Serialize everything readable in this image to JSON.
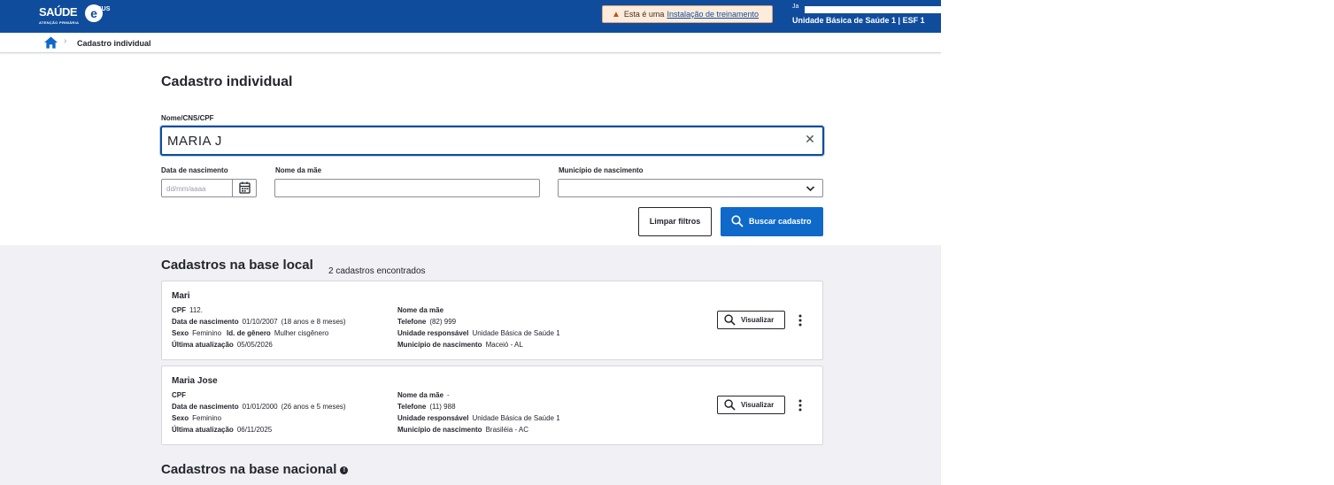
{
  "header": {
    "brand": "SAÚDE",
    "brand_sub": "ATENÇÃO PRIMÁRIA",
    "brand_e": "e",
    "brand_sus": "SUS",
    "training_prefix": "Esta é uma",
    "training_link": "Instalação de treinamento",
    "user_name": "Ja",
    "user_unit": "Unidade Básica de Saúde 1 | ESF 1"
  },
  "breadcrumb": {
    "current": "Cadastro individual"
  },
  "form": {
    "title": "Cadastro individual",
    "search_label": "Nome/CNS/CPF",
    "search_value": "MARIA J",
    "birth_label": "Data de nascimento",
    "birth_placeholder": "dd/mm/aaaa",
    "mother_label": "Nome da mãe",
    "city_label": "Município de nascimento",
    "clear_button": "Limpar filtros",
    "search_button": "Buscar cadastro"
  },
  "local": {
    "title": "Cadastros na base local",
    "count": "2 cadastros encontrados",
    "labels": {
      "cpf": "CPF",
      "birth": "Data de nascimento",
      "sex": "Sexo",
      "gender": "Id. de gênero",
      "updated": "Última atualização",
      "mother": "Nome da mãe",
      "phone": "Telefone",
      "unit": "Unidade responsável",
      "city": "Município de nascimento",
      "view": "Visualizar"
    },
    "records": [
      {
        "name": "Mari",
        "cpf": "112.",
        "birth": "01/10/2007",
        "age": "(18 anos e 8 meses)",
        "sex": "Feminino",
        "gender": "Mulher cisgênero",
        "updated": "05/05/2026",
        "mother": "",
        "phone": "(82) 999",
        "unit": "Unidade Básica de Saúde 1",
        "city": "Maceió - AL"
      },
      {
        "name": "Maria Jose",
        "cpf": "",
        "birth": "01/01/2000",
        "age": "(26 anos e 5 meses)",
        "sex": "Feminino",
        "gender": "",
        "updated": "06/11/2025",
        "mother": "-",
        "phone": "(11) 988",
        "unit": "Unidade Básica de Saúde 1",
        "city": "Brasiléia - AC"
      }
    ]
  },
  "national": {
    "title": "Cadastros na base nacional"
  },
  "colors": {
    "header_bg": "#0f4c9c",
    "primary": "#0f69c9",
    "results_bg": "#f0f0f5",
    "training_bg": "#fdecdc"
  }
}
